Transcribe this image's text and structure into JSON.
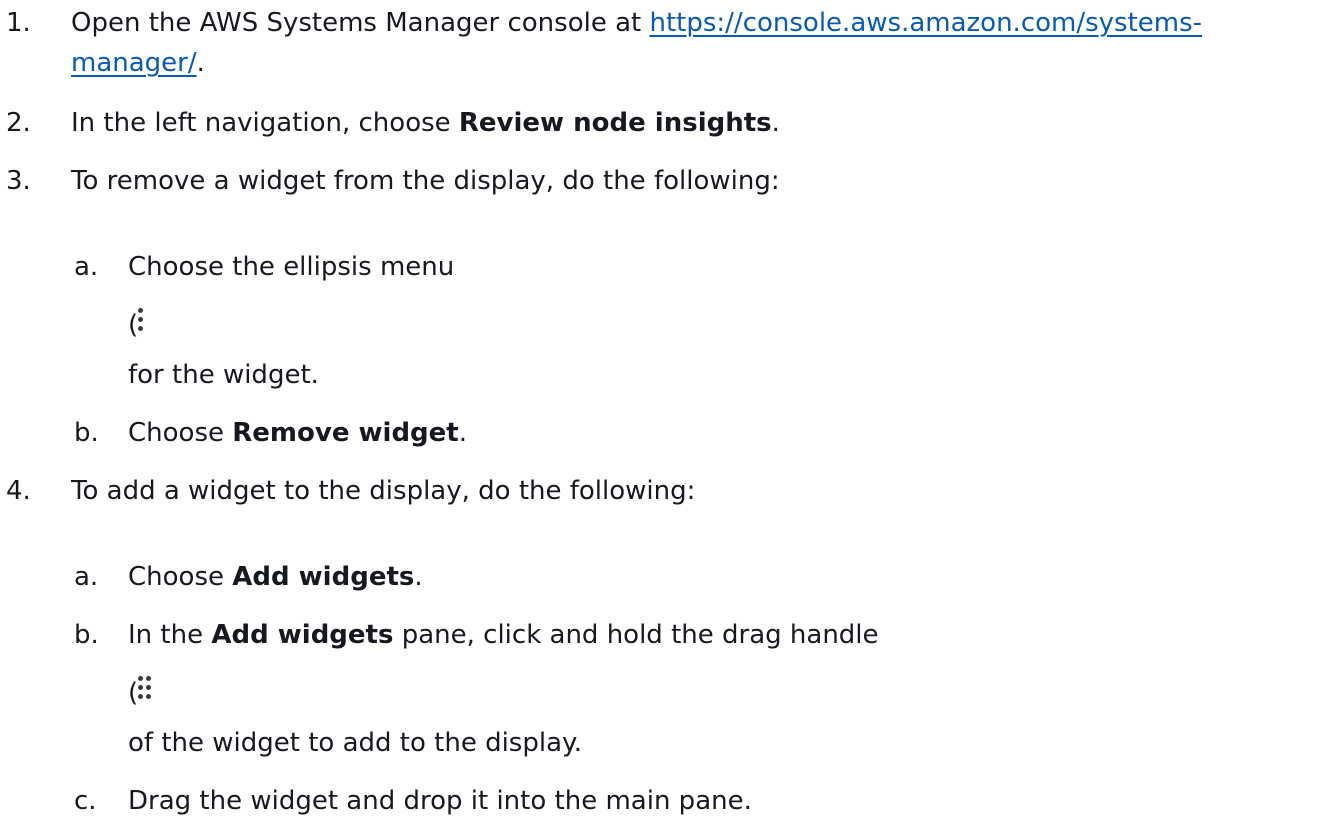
{
  "steps": [
    {
      "number": "1.",
      "text_before": "Open the AWS Systems Manager console at ",
      "link_line1": "https://console.aws.amazon.com/systems-",
      "link_line2": "manager/",
      "text_after": "."
    },
    {
      "number": "2.",
      "text_before": "In the left navigation, choose ",
      "bold": "Review node insights",
      "text_after": "."
    },
    {
      "number": "3.",
      "text": "To remove a widget from the display, do the following:",
      "substeps": [
        {
          "letter": "a.",
          "text": "Choose the ellipsis menu",
          "icon_open": "(",
          "icon": "vertical-ellipsis-icon",
          "continuation": "for the widget."
        },
        {
          "letter": "b.",
          "text_before": "Choose ",
          "bold": "Remove widget",
          "text_after": "."
        }
      ]
    },
    {
      "number": "4.",
      "text": "To add a widget to the display, do the following:",
      "substeps": [
        {
          "letter": "a.",
          "text_before": "Choose ",
          "bold": "Add widgets",
          "text_after": "."
        },
        {
          "letter": "b.",
          "text_before": "In the ",
          "bold": "Add widgets",
          "text_after": " pane, click and hold the drag handle",
          "icon_open": "(",
          "icon": "drag-handle-icon",
          "continuation": "of the widget to add to the display."
        },
        {
          "letter": "c.",
          "text": "Drag the widget and drop it into the main pane."
        }
      ]
    }
  ]
}
